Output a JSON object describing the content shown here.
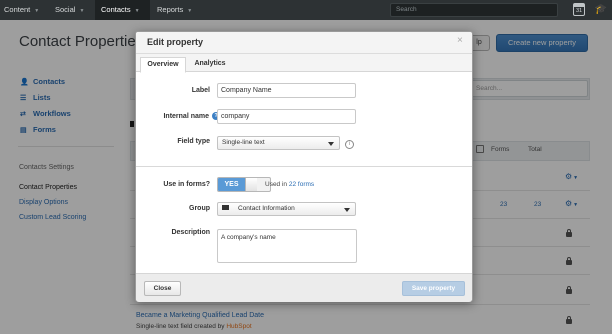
{
  "nav": {
    "items": [
      {
        "label": "Content"
      },
      {
        "label": "Social"
      },
      {
        "label": "Contacts"
      },
      {
        "label": "Reports"
      }
    ],
    "search_placeholder": "Search",
    "calendar_day": "31"
  },
  "page": {
    "title": "Contact Properties",
    "help_label": "lp",
    "create_label": "Create new property"
  },
  "sidebar": {
    "items": [
      {
        "label": "Contacts"
      },
      {
        "label": "Lists"
      },
      {
        "label": "Workflows"
      },
      {
        "label": "Forms"
      }
    ],
    "settings_heading": "Contacts Settings",
    "settings_links": [
      {
        "label": "Contact Properties"
      },
      {
        "label": "Display Options"
      },
      {
        "label": "Custom Lead Scoring"
      }
    ]
  },
  "table": {
    "search_placeholder": "Search...",
    "headers": {
      "forms": "Forms",
      "total": "Total"
    },
    "row_values": {
      "forms": "23",
      "total": "23"
    },
    "last_row": {
      "title": "Became a Marketing Qualified Lead Date",
      "subtitle_prefix": "Single-line text field created by ",
      "subtitle_brand": "HubSpot"
    }
  },
  "modal": {
    "title": "Edit property",
    "close_glyph": "×",
    "tabs": [
      {
        "label": "Overview",
        "active": true
      },
      {
        "label": "Analytics",
        "active": false
      }
    ],
    "fields": {
      "label": {
        "label": "Label",
        "value": "Company Name"
      },
      "internal_name": {
        "label": "Internal name",
        "value": "company",
        "help_glyph": "?"
      },
      "field_type": {
        "label": "Field type",
        "value": "Single-line text"
      },
      "use_in_forms": {
        "label": "Use in forms?",
        "toggle": "YES",
        "used_prefix": "Used in ",
        "used_link": "22 forms"
      },
      "group": {
        "label": "Group",
        "value": "Contact Information"
      },
      "description": {
        "label": "Description",
        "value": "A company's name"
      }
    },
    "close_button": "Close",
    "save_button": "Save property"
  }
}
